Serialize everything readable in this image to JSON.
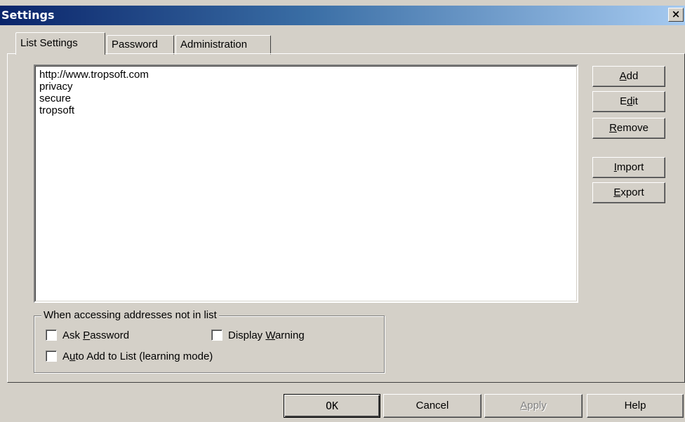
{
  "window": {
    "title": "Settings",
    "close_label": "×"
  },
  "tabs": [
    {
      "label": "List Settings",
      "active": true
    },
    {
      "label": "Password",
      "active": false
    },
    {
      "label": "Administration",
      "active": false
    }
  ],
  "list": {
    "items": [
      "http://www.tropsoft.com",
      "privacy",
      "secure",
      "tropsoft"
    ]
  },
  "side_buttons": {
    "add": {
      "pre": "",
      "key": "A",
      "post": "dd"
    },
    "edit": {
      "pre": "E",
      "key": "d",
      "post": "it"
    },
    "remove": {
      "pre": "",
      "key": "R",
      "post": "emove"
    },
    "import": {
      "pre": "",
      "key": "I",
      "post": "mport"
    },
    "export": {
      "pre": "",
      "key": "E",
      "post": "xport"
    }
  },
  "group": {
    "label": "When accessing addresses not in list",
    "ask_password": {
      "pre": "Ask ",
      "key": "P",
      "post": "assword",
      "checked": false
    },
    "display_warning": {
      "pre": "Display ",
      "key": "W",
      "post": "arning",
      "checked": false
    },
    "auto_add": {
      "pre": "A",
      "key": "u",
      "post": "to Add to List (learning mode)",
      "checked": false
    }
  },
  "footer": {
    "ok": "OK",
    "cancel": "Cancel",
    "apply": {
      "pre": "",
      "key": "A",
      "post": "pply",
      "enabled": false
    },
    "help": "Help"
  }
}
